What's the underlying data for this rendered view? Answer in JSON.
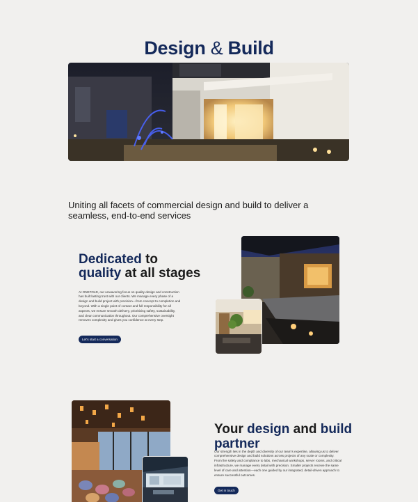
{
  "hero": {
    "title_a": "Design",
    "title_amp": "&",
    "title_b": "Build"
  },
  "tagline": "Uniting all facets of commercial design and build to deliver a seamless, end-to-end services",
  "section_quality": {
    "heading_1": "Dedicated",
    "heading_2": " to ",
    "heading_3": "quality",
    "heading_4": " at all stages",
    "body": "At ONEFOLD, our unwavering focus on quality design and construction has built lasting trust with our clients. We manage every phase of a design and build project with precision—from concept to completion and beyond. With a single point of contact and full responsibility for all aspects, we ensure smooth delivery, prioritizing safety, sustainability, and clear communication throughout. Our comprehensive oversight removes complexity and gives you confidence at every step.",
    "cta": "Let's start a conversation"
  },
  "section_partner": {
    "heading_1": "Your ",
    "heading_2": "design",
    "heading_3": " and ",
    "heading_4": "build",
    "heading_5": " partner",
    "body": "Our strength lies in the depth and diversity of our team's expertise, allowing us to deliver comprehensive design and build solutions across projects of any scale or complexity. From fire safety and compliance to labs, mechanical workshops, server rooms, and critical infrastructure, we manage every detail with precision. Smaller projects receive the same level of care and attention—each one guided by our integrated, detail-driven approach to ensure successful outcomes.",
    "cta": "Get in touch"
  },
  "colors": {
    "background": "#f1f0ee",
    "brand_navy": "#14295a"
  }
}
